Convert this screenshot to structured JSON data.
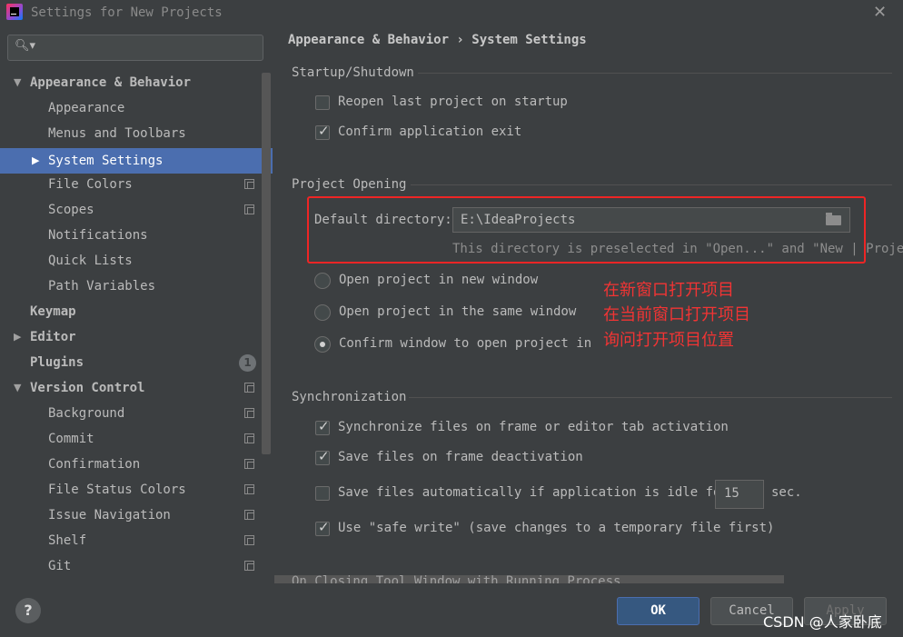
{
  "window": {
    "title": "Settings for New Projects"
  },
  "sidebar": {
    "search_placeholder": "",
    "items": [
      {
        "label": "Appearance & Behavior",
        "expanded": true
      },
      {
        "label": "Appearance"
      },
      {
        "label": "Menus and Toolbars"
      },
      {
        "label": "System Settings",
        "selected": true
      },
      {
        "label": "File Colors"
      },
      {
        "label": "Scopes"
      },
      {
        "label": "Notifications"
      },
      {
        "label": "Quick Lists"
      },
      {
        "label": "Path Variables"
      },
      {
        "label": "Keymap"
      },
      {
        "label": "Editor"
      },
      {
        "label": "Plugins",
        "badge": "1"
      },
      {
        "label": "Version Control",
        "expanded": true
      },
      {
        "label": "Background"
      },
      {
        "label": "Commit"
      },
      {
        "label": "Confirmation"
      },
      {
        "label": "File Status Colors"
      },
      {
        "label": "Issue Navigation"
      },
      {
        "label": "Shelf"
      },
      {
        "label": "Git"
      }
    ]
  },
  "content": {
    "breadcrumb": "Appearance & Behavior › System Settings",
    "startup": {
      "title": "Startup/Shutdown",
      "reopen_label": "Reopen last project on startup",
      "reopen_checked": false,
      "confirm_exit_label": "Confirm application exit",
      "confirm_exit_checked": true
    },
    "project_opening": {
      "title": "Project Opening",
      "dir_label": "Default directory:",
      "dir_value": "E:\\IdeaProjects",
      "dir_hint": "This directory is preselected in \"Open...\" and \"New | Project...",
      "radio_new_window": "Open project in new window",
      "radio_same_window": "Open project in the same window",
      "radio_confirm": "Confirm window to open project in",
      "selected": "radio_confirm"
    },
    "annotations": [
      "在新窗口打开项目",
      "在当前窗口打开项目",
      "询问打开项目位置"
    ],
    "sync": {
      "title": "Synchronization",
      "sync_files_label": "Synchronize files on frame or editor tab activation",
      "sync_files_checked": true,
      "save_deactivation_label": "Save files on frame deactivation",
      "save_deactivation_checked": true,
      "save_idle_label": "Save files automatically if application is idle for",
      "save_idle_checked": false,
      "idle_seconds": "15",
      "idle_unit": "sec.",
      "safe_write_label": "Use \"safe write\" (save changes to a temporary file first)",
      "safe_write_checked": true
    },
    "closing_title": "On Closing Tool Window with Running Process"
  },
  "footer": {
    "help_label": "?",
    "ok_label": "OK",
    "cancel_label": "Cancel",
    "apply_label": "Apply"
  },
  "watermark": "CSDN @人家卧底"
}
